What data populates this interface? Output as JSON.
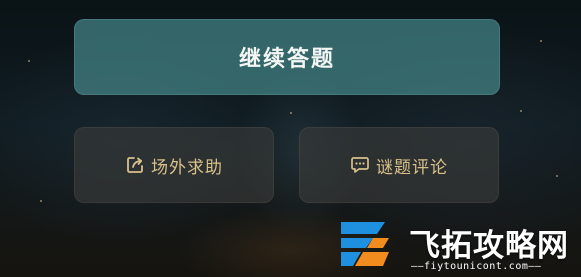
{
  "actions": {
    "continue_label": "继续答题",
    "help_label": "场外求助",
    "comment_label": "谜题评论"
  },
  "watermark": {
    "site_name": "飞拓攻略网",
    "domain": "——fiytounicont.com——"
  },
  "icons": {
    "help": "share-external-icon",
    "comment": "comment-bubble-icon"
  },
  "colors": {
    "primary_button": "#407e80",
    "secondary_button": "#3a3c3a",
    "secondary_text": "#d9c08a",
    "logo_blue": "#1f8fe0",
    "logo_orange": "#f28c1e"
  }
}
